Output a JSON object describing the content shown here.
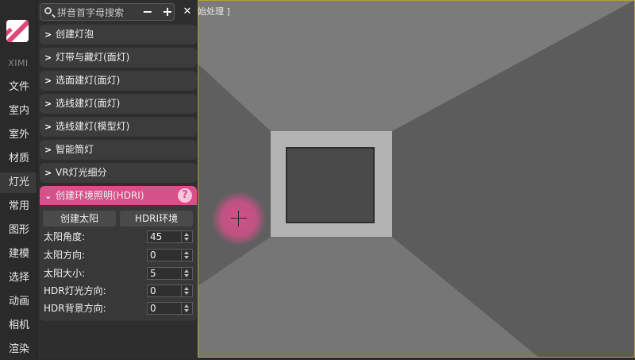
{
  "brand": "XIMI",
  "nav": [
    "文件",
    "室内",
    "室外",
    "材质",
    "灯光",
    "常用",
    "图形",
    "建模",
    "选择",
    "动画",
    "相机",
    "渲染"
  ],
  "active_nav": "灯光",
  "search": {
    "placeholder": "拼音首字母搜索",
    "value": ""
  },
  "toolbar": {
    "minus": "−",
    "plus": "+",
    "close": "✕"
  },
  "sections": [
    "创建灯泡",
    "灯带与藏灯(面灯)",
    "选面建灯(面灯)",
    "选线建灯(面灯)",
    "选线建灯(模型灯)",
    "智能筒灯",
    "VR灯光细分",
    "创建环境照明(HDRI)"
  ],
  "hdri": {
    "help": "?",
    "create_sun_label": "创建太阳",
    "hdri_env_label": "HDRI环境",
    "params": [
      {
        "label": "太阳角度:",
        "value": "45"
      },
      {
        "label": "太阳方向:",
        "value": "0"
      },
      {
        "label": "太阳大小:",
        "value": "5"
      },
      {
        "label": "HDR灯光方向:",
        "value": "0"
      },
      {
        "label": "HDR背景方向:",
        "value": "0"
      }
    ]
  },
  "viewport": {
    "caption": "始处理 ]"
  },
  "colors": {
    "accent": "#d6508a",
    "panel": "#2e2e2e",
    "section": "#3c3c3c"
  }
}
